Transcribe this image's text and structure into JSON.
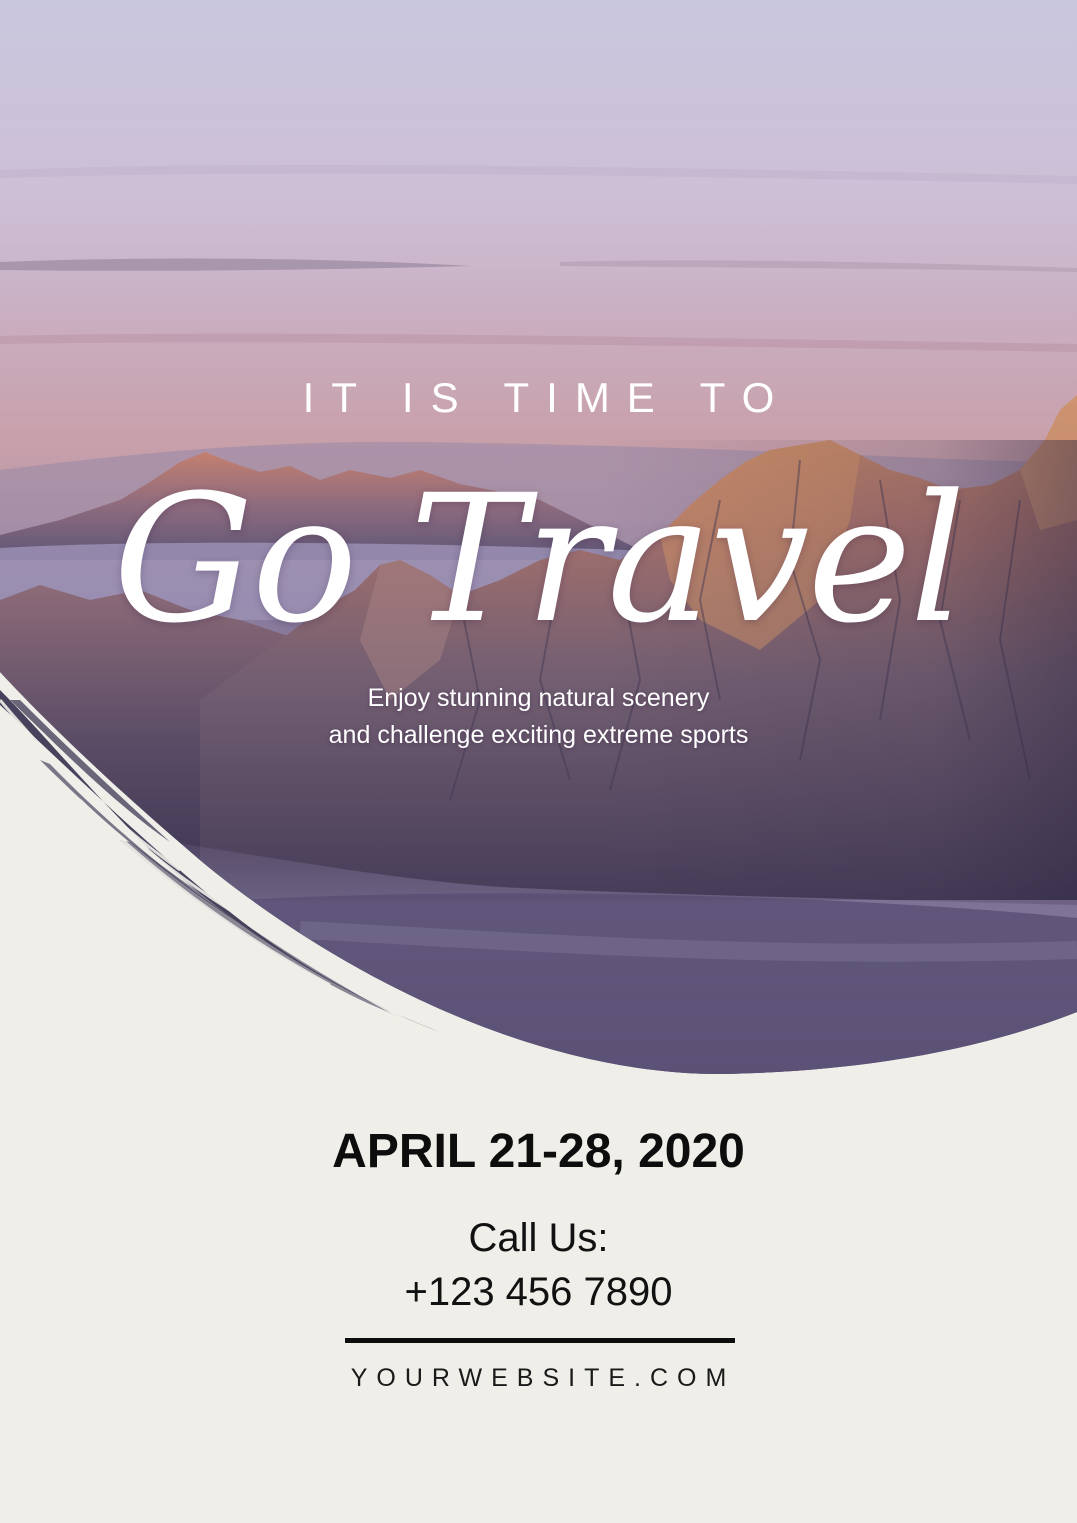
{
  "hero": {
    "eyebrow": "IT IS TIME TO",
    "title": "Go Travel",
    "subtitle_line1": "Enjoy stunning natural scenery",
    "subtitle_line2": "and challenge exciting extreme sports"
  },
  "event": {
    "date": "APRIL 21-28, 2020"
  },
  "contact": {
    "call_label": "Call Us:",
    "phone": "+123 456 7890",
    "website": "YOURWEBSITE.COM"
  },
  "colors": {
    "background": "#efeee8",
    "text_dark": "#0d0d0d",
    "text_light": "#ffffff",
    "sky_top": "#c9c6de",
    "sky_bottom": "#c89aa6",
    "mountain_warm": "#b8785e",
    "mist": "#5c4f73"
  }
}
